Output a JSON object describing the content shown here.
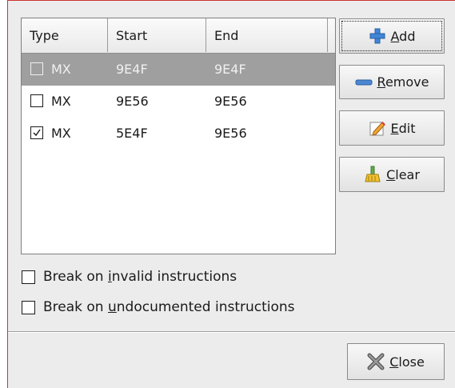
{
  "columns": [
    "Type",
    "Start",
    "End"
  ],
  "rows": [
    {
      "checked": false,
      "type": "MX",
      "start": "9E4F",
      "end": "9E4F",
      "selected": true
    },
    {
      "checked": false,
      "type": "MX",
      "start": "9E56",
      "end": "9E56",
      "selected": false
    },
    {
      "checked": true,
      "type": "MX",
      "start": "5E4F",
      "end": "9E56",
      "selected": false
    }
  ],
  "buttons": {
    "add": {
      "mnemonic": "A",
      "rest": "dd",
      "icon": "plus-icon"
    },
    "remove": {
      "mnemonic": "R",
      "rest": "emove",
      "icon": "minus-icon"
    },
    "edit": {
      "mnemonic": "E",
      "rest": "dit",
      "icon": "pencil-icon"
    },
    "clear": {
      "mnemonic": "C",
      "rest": "lear",
      "icon": "broom-icon"
    },
    "close": {
      "mnemonic": "C",
      "rest": "lose",
      "icon": "close-icon"
    }
  },
  "options": [
    {
      "pre": "Break on ",
      "mnemonic": "i",
      "post": "nvalid instructions",
      "checked": false
    },
    {
      "pre": "Break on ",
      "mnemonic": "u",
      "post": "ndocumented instructions",
      "checked": false
    }
  ],
  "colors": {
    "selection": "#9f9f9f",
    "plus": "#3f86d8",
    "minus": "#4b87d3"
  }
}
